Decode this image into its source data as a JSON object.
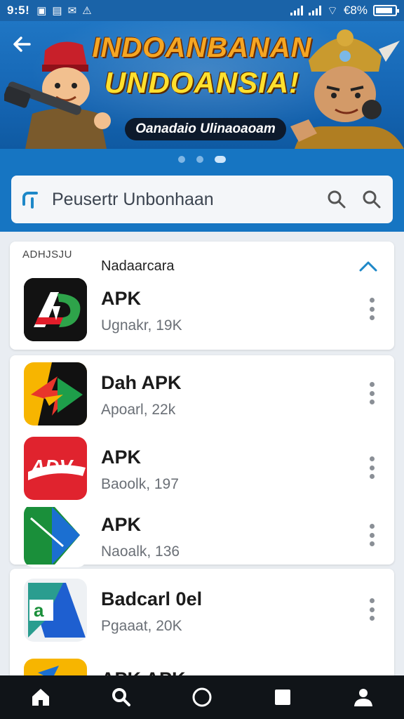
{
  "status_bar": {
    "time": "9:5!",
    "battery": "€8%",
    "battery_level": 0.88
  },
  "banner": {
    "title_line1": "INDOANBANAN",
    "title_line2": "UNDOANSIA!",
    "subtitle": "Oanadaio Ulinaoaoam"
  },
  "carousel": {
    "count": 3,
    "active_index": 2
  },
  "search": {
    "text": "Peusertr Unbonhaan"
  },
  "section": {
    "tag": "ADHJSJU",
    "title": "Nadaarcara"
  },
  "apps": [
    {
      "name": "APK",
      "meta": "Ugnakr, 19K",
      "icon": "ad-logo-icon",
      "colors": [
        "#111111",
        "#e11d2a",
        "#2ea34a"
      ]
    },
    {
      "name": "Dah APK",
      "meta": "Apoarl, 22k",
      "icon": "arrow-logo-icon",
      "colors": [
        "#f7b500",
        "#e8352b",
        "#1e9e4a"
      ]
    },
    {
      "name": "APK",
      "meta": "Baoolk, 197",
      "icon": "adv-logo-icon",
      "colors": [
        "#e0232e",
        "#ffffff"
      ]
    },
    {
      "name": "APK",
      "meta": "Naoalk, 136",
      "icon": "play-logo-icon",
      "colors": [
        "#1a8f3a",
        "#1b6fd1"
      ]
    },
    {
      "name": "Badcarl 0el",
      "meta": "Pgaaat, 20K",
      "icon": "a-logo-icon",
      "colors": [
        "#2a9d8f",
        "#1e5fd0"
      ]
    },
    {
      "name": "APK APK",
      "meta": "",
      "icon": "partial-logo-icon",
      "colors": [
        "#f7b500",
        "#1b6fd1"
      ]
    }
  ],
  "nav": [
    "home-icon",
    "search-icon",
    "circle-home-icon",
    "square-icon",
    "profile-icon"
  ]
}
